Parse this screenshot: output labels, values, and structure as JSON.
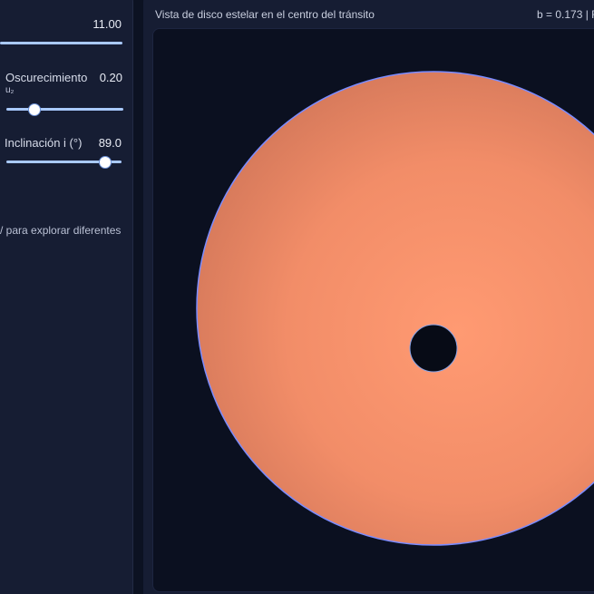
{
  "controls": {
    "top_value": "11.00",
    "limb_darkening": {
      "label": "Oscurecimiento",
      "sub_label": "u₂",
      "value": "0.20",
      "fraction": 0.2
    },
    "inclination": {
      "label": "Inclinación i (°)",
      "value": "89.0",
      "fraction": 0.83
    },
    "hint": "/ para explorar diferentes"
  },
  "view": {
    "title": "Vista de disco estelar en el centro del tránsito",
    "readout": "b = 0.173 | R"
  },
  "colors": {
    "star_center": "#ff9a72",
    "star_edge": "#d4785a",
    "star_outline": "#7b8cff",
    "planet": "#070b16",
    "planet_outline": "#8aa4e6"
  }
}
